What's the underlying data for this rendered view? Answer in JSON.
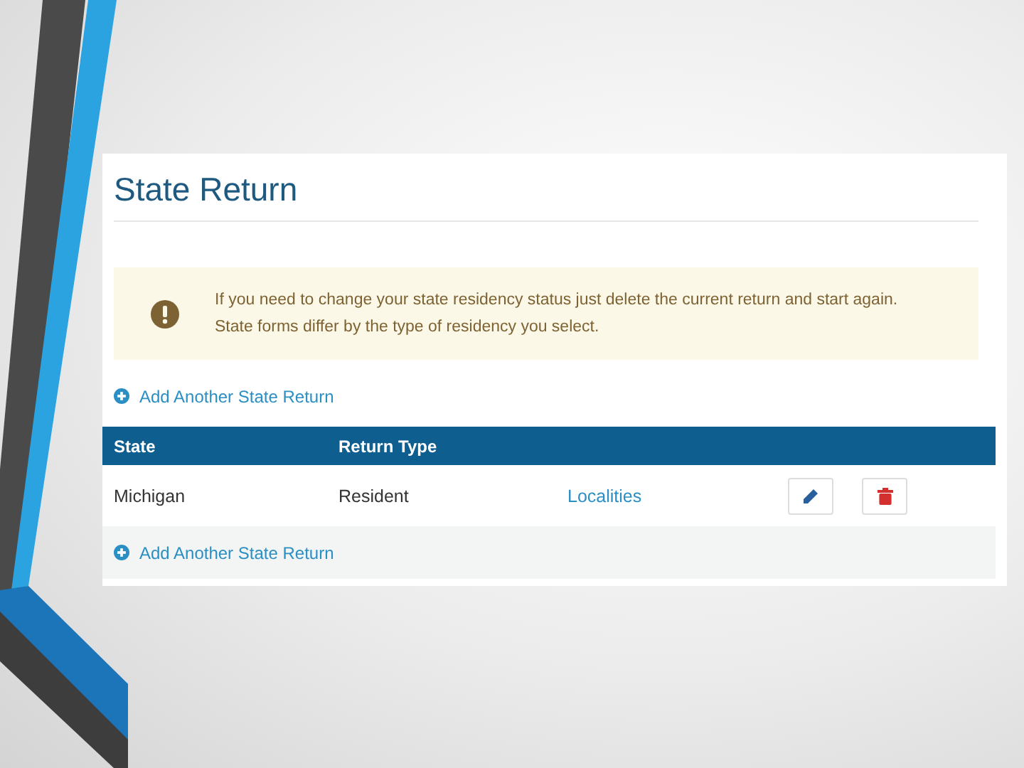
{
  "title": "State Return",
  "alert": {
    "text": "If you need to change your state residency status just delete the current return and start again. State forms differ by the type of residency you select."
  },
  "add_link": "Add Another State Return",
  "table": {
    "columns": [
      "State",
      "Return Type"
    ],
    "rows": [
      {
        "state": "Michigan",
        "return_type": "Resident",
        "link": "Localities"
      }
    ]
  },
  "footer_link": "Add Another State Return"
}
